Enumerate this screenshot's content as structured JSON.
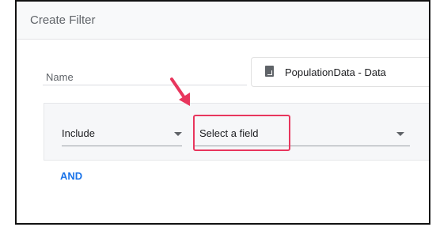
{
  "dialog": {
    "title": "Create Filter"
  },
  "name_field": {
    "label": "Name",
    "value": ""
  },
  "data_source": {
    "icon": "sheets-icon",
    "name": "PopulationData - Data"
  },
  "clause": {
    "operator": "Include",
    "field_placeholder": "Select a field"
  },
  "actions": {
    "and_label": "AND"
  },
  "annotation": {
    "highlight_color": "#e8365d"
  },
  "colors": {
    "accent": "#1a73e8",
    "header_bg": "#f8f9fa",
    "clause_bg": "#f6f7f9"
  }
}
